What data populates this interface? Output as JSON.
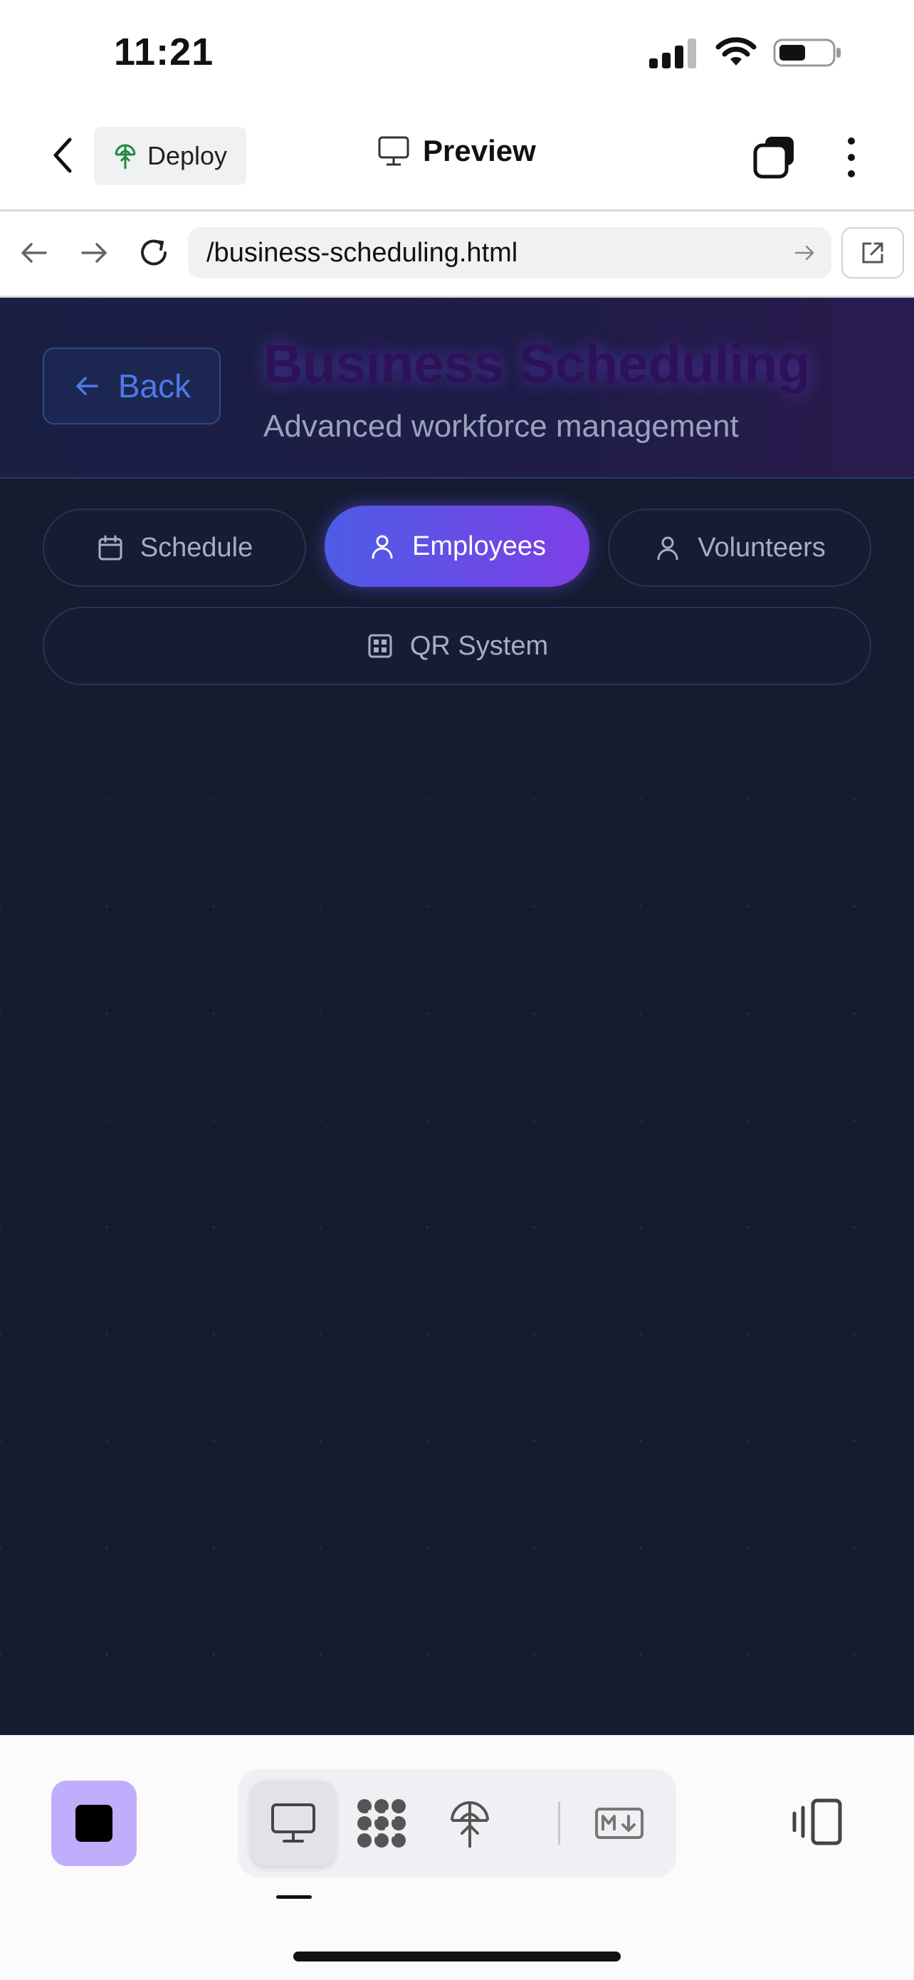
{
  "status_bar": {
    "time": "11:21"
  },
  "app_toolbar": {
    "deploy_label": "Deploy",
    "title": "Preview"
  },
  "browser": {
    "url": "/business-scheduling.html"
  },
  "web": {
    "back_label": "Back",
    "title": "Business Scheduling",
    "subtitle": "Advanced workforce management",
    "tabs": [
      {
        "label": "Schedule",
        "icon": "calendar-icon",
        "active": false
      },
      {
        "label": "Employees",
        "icon": "user-icon",
        "active": true
      },
      {
        "label": "Volunteers",
        "icon": "user-icon",
        "active": false
      },
      {
        "label": "QR System",
        "icon": "qr-grid-icon",
        "active": false
      }
    ],
    "colors": {
      "background": "#141c30",
      "accent_start": "#4d5ce6",
      "accent_end": "#7e3fe6",
      "back_text": "#4f79ea"
    }
  },
  "dock": {
    "modes": [
      "preview-icon",
      "mesh-icon",
      "deploy-icon",
      "markdown-icon"
    ],
    "active_mode": "preview-icon",
    "stop_color": "#c0aefc"
  }
}
